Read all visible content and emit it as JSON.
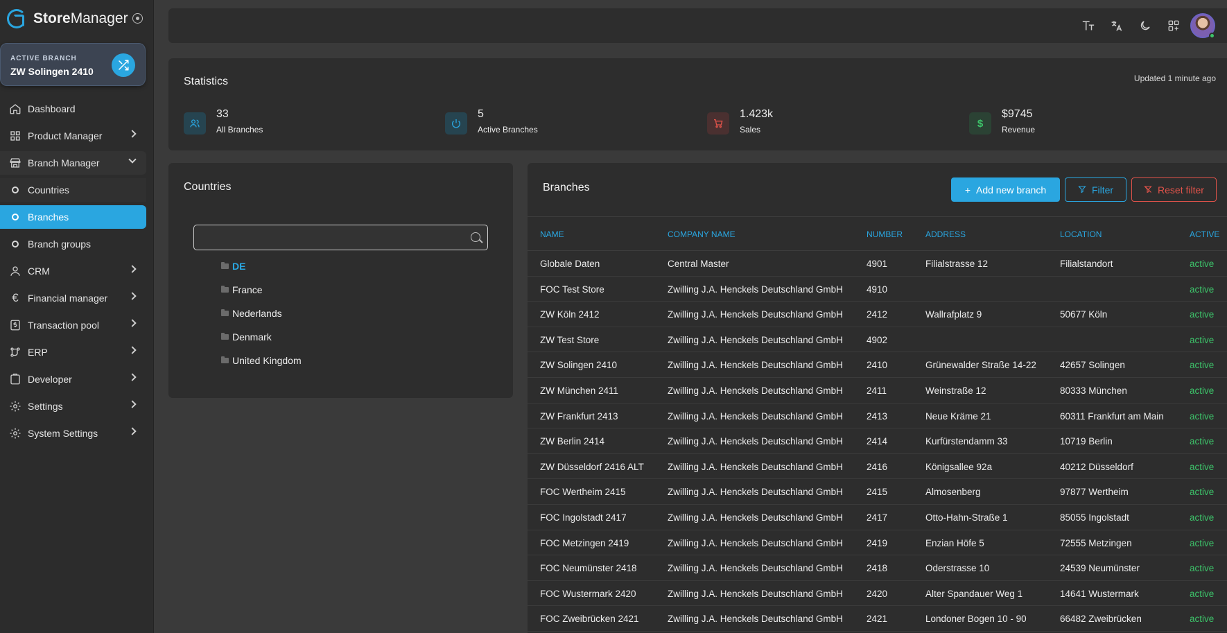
{
  "app": {
    "name_bold": "Store",
    "name_rest": "Manager"
  },
  "active_branch": {
    "label": "ACTIVE BRANCH",
    "value": "ZW Solingen 2410"
  },
  "nav": [
    {
      "label": "Dashboard",
      "icon": "home-icon"
    },
    {
      "label": "Product Manager",
      "icon": "grid-icon"
    },
    {
      "label": "Branch Manager",
      "icon": "store-icon"
    },
    {
      "label": "Countries"
    },
    {
      "label": "Branches"
    },
    {
      "label": "Branch groups"
    },
    {
      "label": "CRM",
      "icon": "user-icon"
    },
    {
      "label": "Financial manager",
      "icon": "euro-icon"
    },
    {
      "label": "Transaction pool",
      "icon": "receipt-icon"
    },
    {
      "label": "ERP",
      "icon": "route-icon"
    },
    {
      "label": "Developer",
      "icon": "clipboard-icon"
    },
    {
      "label": "Settings",
      "icon": "gear-icon"
    },
    {
      "label": "System Settings",
      "icon": "gear-icon"
    }
  ],
  "topbar": {
    "icons": [
      "text-size-icon",
      "translate-icon",
      "dark-mode-icon",
      "apps-icon"
    ]
  },
  "statistics": {
    "title": "Statistics",
    "updated": "Updated 1 minute ago",
    "items": [
      {
        "value": "33",
        "label": "All Branches",
        "icon": "users-icon",
        "color": "#2aa6e0"
      },
      {
        "value": "5",
        "label": "Active Branches",
        "icon": "power-icon",
        "color": "#2aa6e0"
      },
      {
        "value": "1.423k",
        "label": "Sales",
        "icon": "cart-icon",
        "color": "#e0534a"
      },
      {
        "value": "$9745",
        "label": "Revenue",
        "icon": "dollar-icon",
        "color": "#3dc46a"
      }
    ]
  },
  "countries": {
    "title": "Countries",
    "search_placeholder": "",
    "items": [
      "DE",
      "France",
      "Nederlands",
      "Denmark",
      "United Kingdom"
    ]
  },
  "branches": {
    "title": "Branches",
    "add_label": "Add new branch",
    "filter_label": "Filter",
    "reset_label": "Reset filter",
    "columns": [
      "Name",
      "Company name",
      "Number",
      "Address",
      "Location",
      "Active"
    ],
    "rows": [
      [
        "Globale Daten",
        "Central Master",
        "4901",
        "Filialstrasse 12",
        "Filialstandort",
        "active"
      ],
      [
        "FOC Test Store",
        "Zwilling J.A. Henckels Deutschland GmbH",
        "4910",
        "",
        "",
        "active"
      ],
      [
        "ZW Köln 2412",
        "Zwilling J.A. Henckels Deutschland GmbH",
        "2412",
        "Wallrafplatz 9",
        "50677 Köln",
        "active"
      ],
      [
        "ZW Test Store",
        "Zwilling J.A. Henckels Deutschland GmbH",
        "4902",
        "",
        "",
        "active"
      ],
      [
        "ZW Solingen 2410",
        "Zwilling J.A. Henckels Deutschland GmbH",
        "2410",
        "Grünewalder Straße 14-22",
        "42657 Solingen",
        "active"
      ],
      [
        "ZW München 2411",
        "Zwilling J.A. Henckels Deutschland GmbH",
        "2411",
        "Weinstraße 12",
        "80333 München",
        "active"
      ],
      [
        "ZW Frankfurt 2413",
        "Zwilling J.A. Henckels Deutschland GmbH",
        "2413",
        "Neue Kräme 21",
        "60311 Frankfurt am Main",
        "active"
      ],
      [
        "ZW Berlin 2414",
        "Zwilling J.A. Henckels Deutschland GmbH",
        "2414",
        "Kurfürstendamm 33",
        "10719 Berlin",
        "active"
      ],
      [
        "ZW Düsseldorf 2416 ALT",
        "Zwilling J.A. Henckels Deutschland GmbH",
        "2416",
        "Königsallee 92a",
        "40212 Düsseldorf",
        "active"
      ],
      [
        "FOC Wertheim 2415",
        "Zwilling J.A. Henckels Deutschland GmbH",
        "2415",
        "Almosenberg",
        "97877 Wertheim",
        "active"
      ],
      [
        "FOC Ingolstadt 2417",
        "Zwilling J.A. Henckels Deutschland GmbH",
        "2417",
        "Otto-Hahn-Straße 1",
        "85055 Ingolstadt",
        "active"
      ],
      [
        "FOC Metzingen 2419",
        "Zwilling J.A. Henckels Deutschland GmbH",
        "2419",
        "Enzian Höfe 5",
        "72555 Metzingen",
        "active"
      ],
      [
        "FOC Neumünster 2418",
        "Zwilling J.A. Henckels Deutschland GmbH",
        "2418",
        "Oderstrasse 10",
        "24539 Neumünster",
        "active"
      ],
      [
        "FOC Wustermark 2420",
        "Zwilling J.A. Henckels Deutschland GmbH",
        "2420",
        "Alter Spandauer Weg 1",
        "14641 Wustermark",
        "active"
      ],
      [
        "FOC Zweibrücken 2421",
        "Zwilling J.A. Henckels Deutschland GmbH",
        "2421",
        "Londoner Bogen 10 - 90",
        "66482 Zweibrücken",
        "active"
      ]
    ]
  }
}
